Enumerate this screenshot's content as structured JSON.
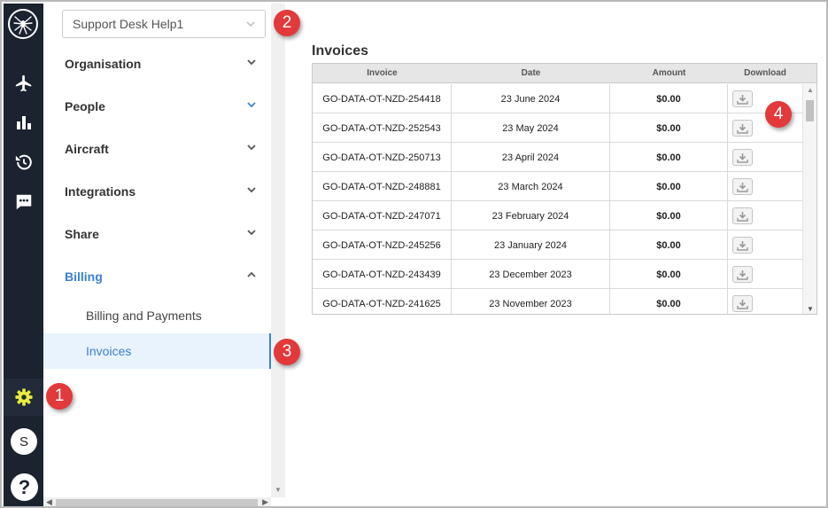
{
  "organisation_selector": {
    "value": "Support Desk Help1"
  },
  "rail": {
    "icons": [
      "spider-logo-icon",
      "airplane-icon",
      "bar-chart-icon",
      "history-icon",
      "chat-icon",
      "gear-icon"
    ],
    "avatar_initial": "S",
    "help_label": "?",
    "accent": "#e8ec3c"
  },
  "nav": {
    "items": [
      {
        "label": "Organisation",
        "expanded": false
      },
      {
        "label": "People",
        "expanded": false
      },
      {
        "label": "Aircraft",
        "expanded": false
      },
      {
        "label": "Integrations",
        "expanded": false
      },
      {
        "label": "Share",
        "expanded": false
      },
      {
        "label": "Billing",
        "expanded": true
      }
    ],
    "billing_subitems": [
      {
        "label": "Billing and Payments",
        "active": false
      },
      {
        "label": "Invoices",
        "active": true
      }
    ],
    "active_color": "#3b82d1"
  },
  "main": {
    "title": "Invoices",
    "columns": [
      "Invoice",
      "Date",
      "Amount",
      "Download"
    ],
    "rows": [
      {
        "invoice": "GO-DATA-OT-NZD-254418",
        "date": "23 June 2024",
        "amount": "$0.00"
      },
      {
        "invoice": "GO-DATA-OT-NZD-252543",
        "date": "23 May 2024",
        "amount": "$0.00"
      },
      {
        "invoice": "GO-DATA-OT-NZD-250713",
        "date": "23 April 2024",
        "amount": "$0.00"
      },
      {
        "invoice": "GO-DATA-OT-NZD-248881",
        "date": "23 March 2024",
        "amount": "$0.00"
      },
      {
        "invoice": "GO-DATA-OT-NZD-247071",
        "date": "23 February 2024",
        "amount": "$0.00"
      },
      {
        "invoice": "GO-DATA-OT-NZD-245256",
        "date": "23 January 2024",
        "amount": "$0.00"
      },
      {
        "invoice": "GO-DATA-OT-NZD-243439",
        "date": "23 December 2023",
        "amount": "$0.00"
      },
      {
        "invoice": "GO-DATA-OT-NZD-241625",
        "date": "23 November 2023",
        "amount": "$0.00"
      }
    ]
  },
  "callouts": [
    "1",
    "2",
    "3",
    "4"
  ],
  "callout_color": "#e2393a"
}
